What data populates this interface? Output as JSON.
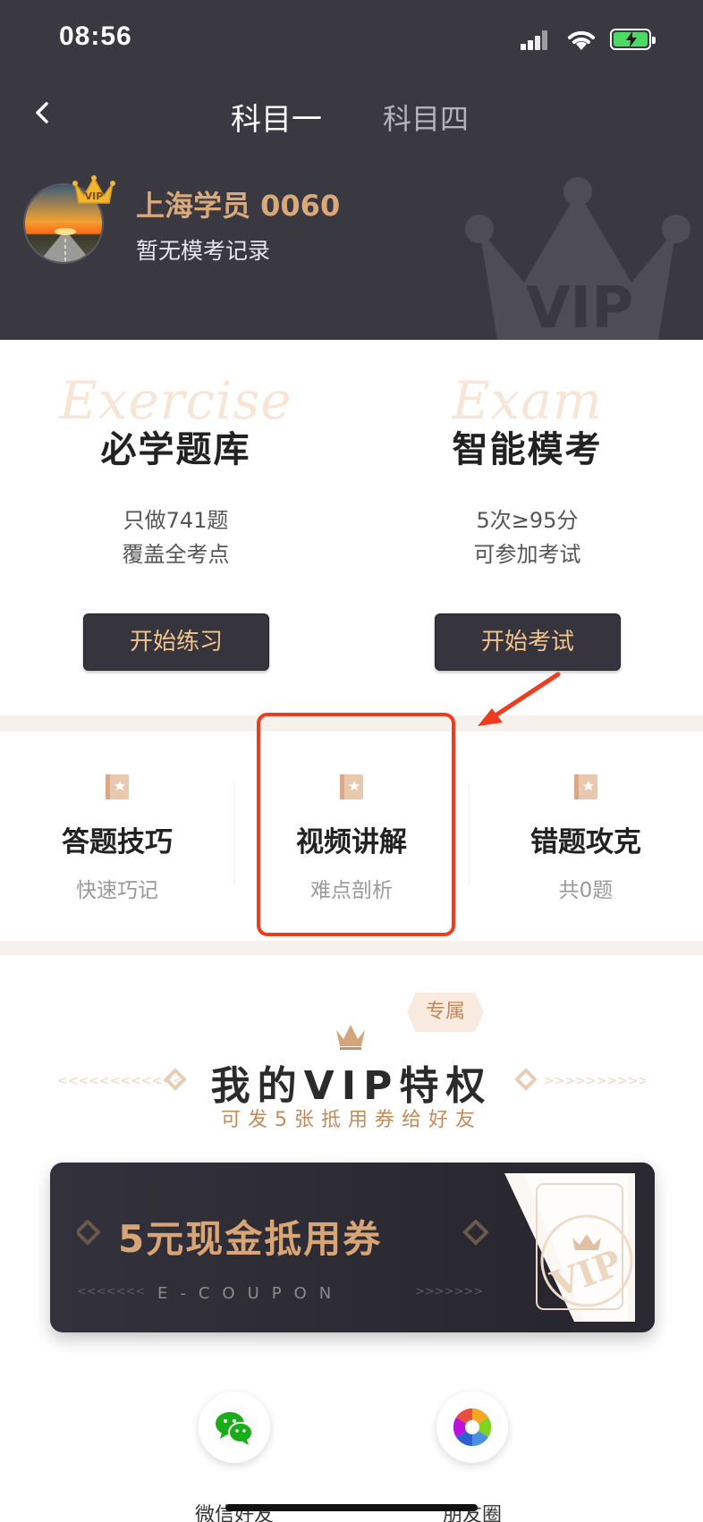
{
  "status_bar": {
    "time": "08:56"
  },
  "nav": {
    "tabs": [
      {
        "label": "科目一",
        "active": true
      },
      {
        "label": "科目四",
        "active": false
      }
    ]
  },
  "profile": {
    "name": "上海学员 0060",
    "subtitle": "暂无模考记录",
    "avatar_badge": "VIP",
    "watermark": "VIP"
  },
  "features": [
    {
      "bg_word": "Exercise",
      "title": "必学题库",
      "desc_line1": "只做741题",
      "desc_line2": "覆盖全考点",
      "button": "开始练习"
    },
    {
      "bg_word": "Exam",
      "title": "智能模考",
      "desc_line1": "5次≥95分",
      "desc_line2": "可参加考试",
      "button": "开始考试"
    }
  ],
  "tools": [
    {
      "title": "答题技巧",
      "subtitle": "快速巧记"
    },
    {
      "title": "视频讲解",
      "subtitle": "难点剖析"
    },
    {
      "title": "错题攻克",
      "subtitle": "共0题"
    }
  ],
  "vip": {
    "tag": "专属",
    "title": "我的VIP特权",
    "subtitle": "可发5张抵用券给好友",
    "coupon_title": "5元现金抵用券",
    "coupon_sub": "E-COUPON",
    "coupon_stub_text": "VIP"
  },
  "share": [
    {
      "label": "微信好友"
    },
    {
      "label": "朋友圈"
    }
  ],
  "colors": {
    "header_bg": "#3a3841",
    "gold": "#d9a97a",
    "button_text": "#f1c48e",
    "highlight": "#f03c1e"
  }
}
